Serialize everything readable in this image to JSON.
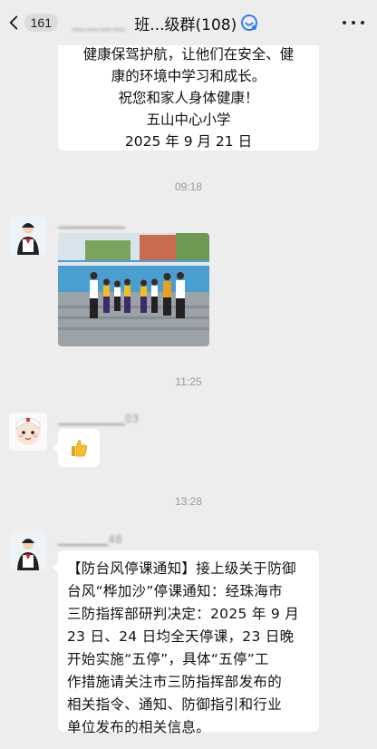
{
  "header": {
    "back_count": "161",
    "group_name_obscured": "▁▁▁▁",
    "group_name": "班...级群(108)",
    "icons": [
      "back-icon",
      "group-chat-badge-icon",
      "more-icon"
    ]
  },
  "messages": [
    {
      "type": "text",
      "lines": [
        "健康保驾护航，让他们在安全、健",
        "康的环境中学习和成长。",
        "祝您和家人身体健康！",
        "五山中心小学",
        "2025 年 9 月 21 日"
      ]
    },
    {
      "type": "time",
      "text": "09:18"
    },
    {
      "type": "image",
      "sender": "▁▁▁▁▁▁▁▁"
    },
    {
      "type": "time",
      "text": "11:25"
    },
    {
      "type": "sticker",
      "sender": "▁▁▁▁▁▁▁▁03",
      "emoji": "👍"
    },
    {
      "type": "time",
      "text": "13:28"
    },
    {
      "type": "text",
      "sender": "▁▁▁▁▁▁48",
      "lines": [
        "【防台风停课通知】接上级关于防御",
        "台风“桦加沙”停课通知：经珠海市",
        "三防指挥部研判决定：2025 年 9 月",
        "23 日、24 日均全天停课，23 日晚",
        "开始实施“五停”，具体“五停”工",
        "作措施请关注市三防指挥部发布的",
        "相关指令、通知、防御指引和行业",
        "单位发布的相关信息。"
      ]
    }
  ],
  "colors": {
    "background": "#ededed",
    "bubble": "#ffffff",
    "time_text": "#999999"
  }
}
